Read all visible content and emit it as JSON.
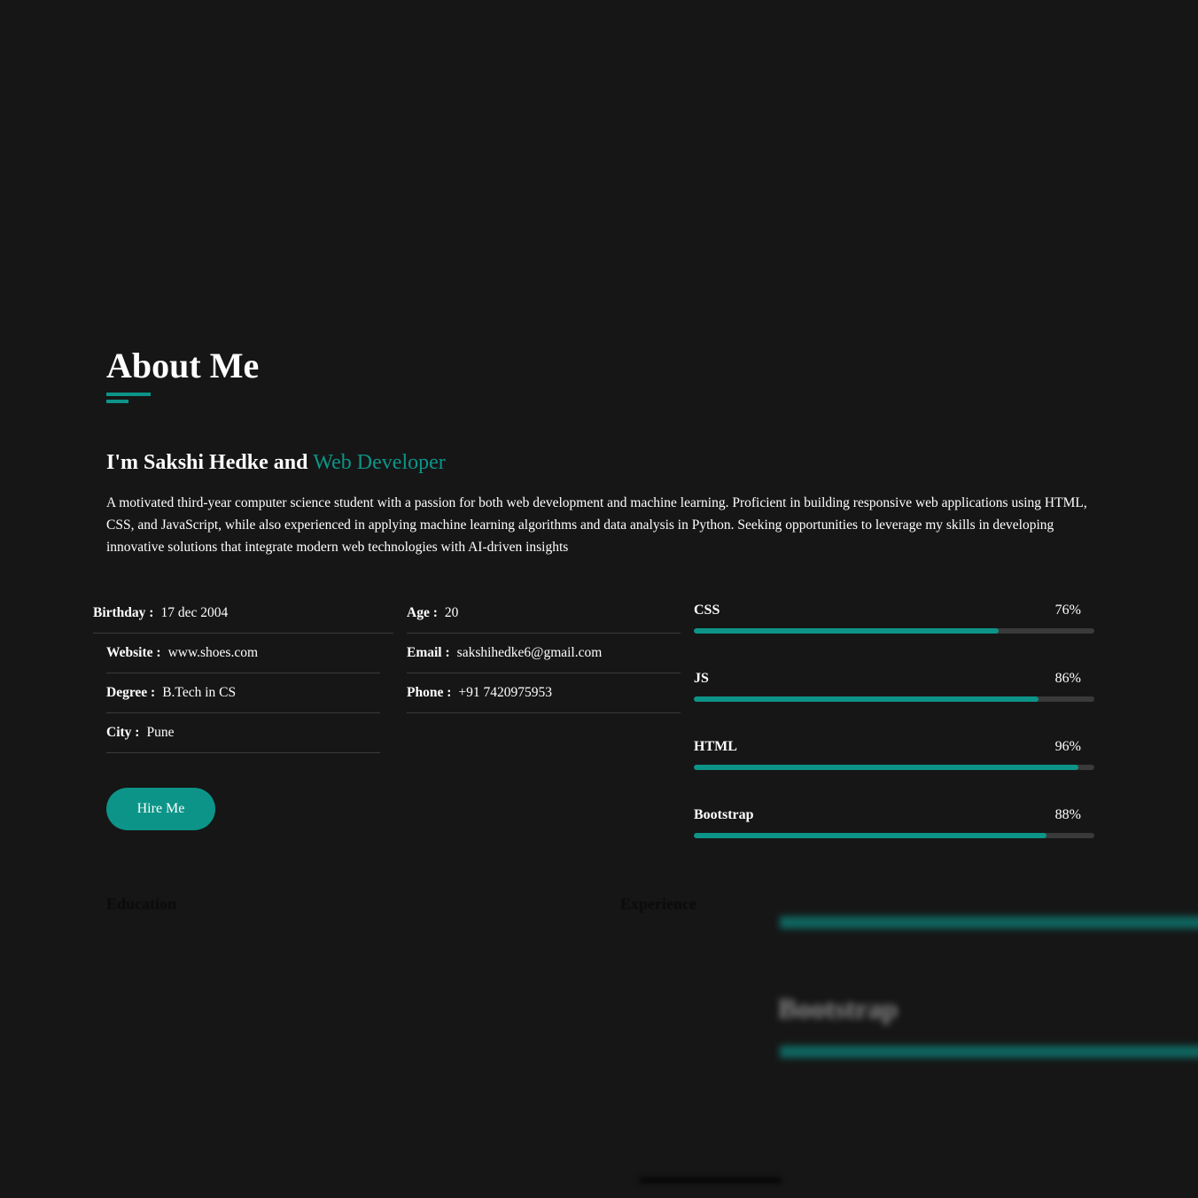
{
  "about": {
    "title": "About Me",
    "intro_prefix": "I'm Sakshi Hedke and ",
    "intro_role": "Web Developer",
    "description": "A motivated third-year computer science student with a passion for both web development and machine learning. Proficient in building responsive web applications using HTML, CSS, and JavaScript, while also experienced in applying machine learning algorithms and data analysis in Python. Seeking opportunities to leverage my skills in developing innovative solutions that integrate modern web technologies with AI-driven insights"
  },
  "info": {
    "birthday": {
      "label": "Birthday :",
      "value": "17 dec 2004"
    },
    "website": {
      "label": "Website :",
      "value": "www.shoes.com"
    },
    "degree": {
      "label": "Degree :",
      "value": "B.Tech in CS"
    },
    "city": {
      "label": "City :",
      "value": "Pune"
    },
    "age": {
      "label": "Age :",
      "value": "20"
    },
    "email": {
      "label": "Email :",
      "value": "sakshihedke6@gmail.com"
    },
    "phone": {
      "label": "Phone :",
      "value": "+91 7420975953"
    }
  },
  "hire_button_label": "Hire Me",
  "skills": [
    {
      "name": "CSS",
      "percent_label": "76%",
      "level": 76
    },
    {
      "name": "JS",
      "percent_label": "86%",
      "level": 86
    },
    {
      "name": "HTML",
      "percent_label": "96%",
      "level": 96
    },
    {
      "name": "Bootstrap",
      "percent_label": "88%",
      "level": 88
    }
  ],
  "sections": {
    "education": "Education",
    "experience": "Experience"
  },
  "blurred_overlay": {
    "skill_name": "Bootstrap"
  },
  "colors": {
    "background": "#161616",
    "accent": "#0d9488",
    "track": "#3a3a3a",
    "text": "#ffffff"
  }
}
